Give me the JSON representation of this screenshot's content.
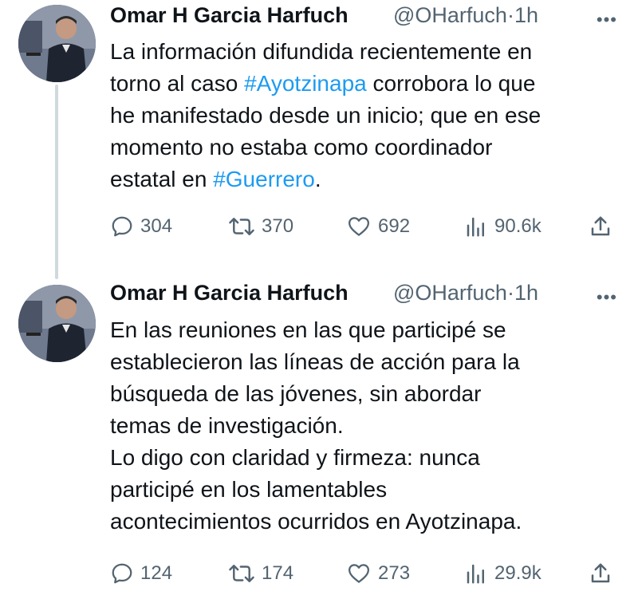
{
  "tweets": [
    {
      "author_name": "Omar H Garcia Harfuch",
      "handle": "@OHarfuch",
      "separator": "·",
      "time": "1h",
      "body_parts": [
        {
          "text": "La información difundida recientemente en\ntorno al caso ",
          "type": "text"
        },
        {
          "text": "#Ayotzinapa",
          "type": "hashtag"
        },
        {
          "text": " corrobora lo que\nhe manifestado desde un inicio; que en ese\nmomento no estaba como coordinador\nestatal en ",
          "type": "text"
        },
        {
          "text": "#Guerrero",
          "type": "hashtag"
        },
        {
          "text": ".",
          "type": "text"
        }
      ],
      "replies": "304",
      "retweets": "370",
      "likes": "692",
      "views": "90.6k"
    },
    {
      "author_name": "Omar H Garcia Harfuch",
      "handle": "@OHarfuch",
      "separator": "·",
      "time": "1h",
      "body_parts": [
        {
          "text": "En las reuniones en las que participé se\nestablecieron las líneas de acción para la\nbúsqueda de las jóvenes, sin abordar\ntemas de investigación.\nLo digo con claridad y firmeza: nunca\nparticipé en los lamentables\nacontecimientos ocurridos en Ayotzinapa.",
          "type": "text"
        }
      ],
      "replies": "124",
      "retweets": "174",
      "likes": "273",
      "views": "29.9k"
    }
  ],
  "icons": {
    "more": "more-dots-icon",
    "reply": "reply-icon",
    "retweet": "retweet-icon",
    "like": "heart-icon",
    "views": "views-icon",
    "share": "share-icon"
  },
  "colors": {
    "hashtag": "#1d9bf0",
    "secondary_text": "#536471",
    "primary_text": "#0f1419",
    "thread_line": "#cfd9de"
  }
}
